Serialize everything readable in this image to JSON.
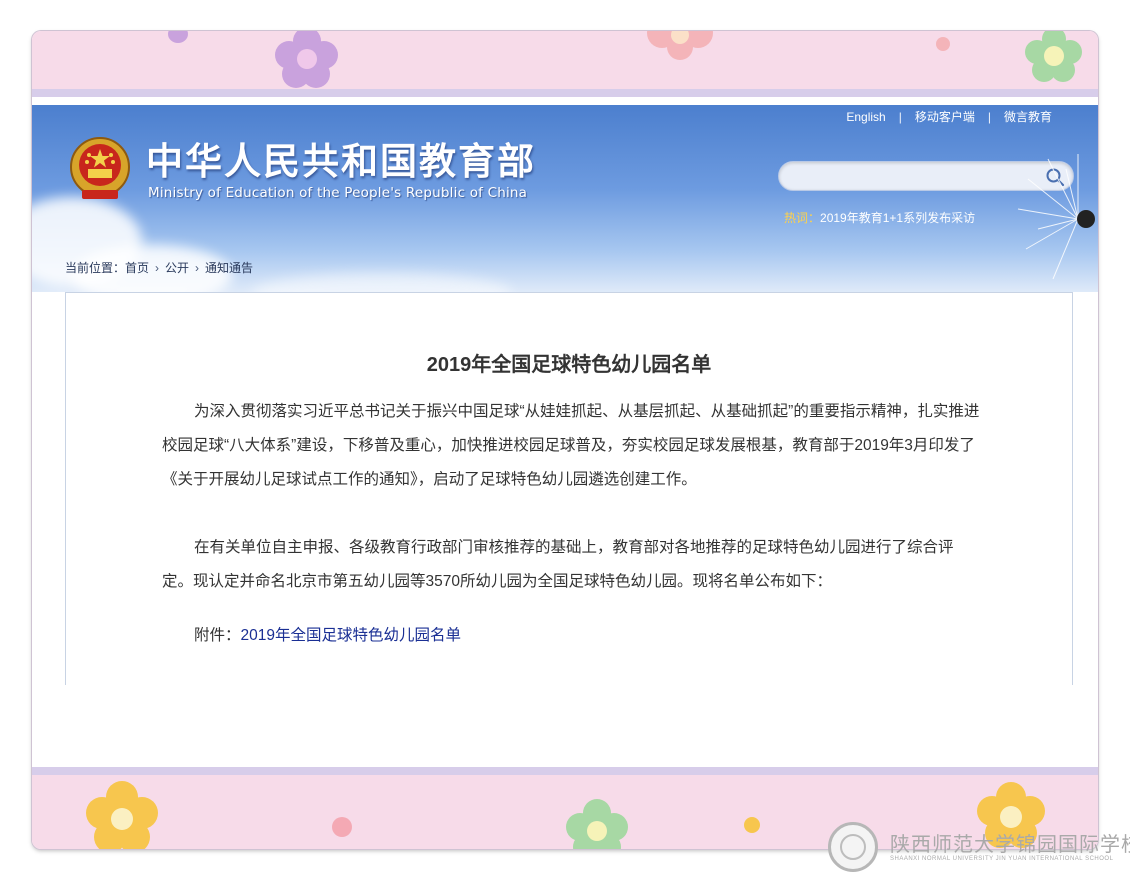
{
  "header": {
    "title_cn": "中华人民共和国教育部",
    "title_en": "Ministry of Education of the People's Republic of China",
    "links": [
      "English",
      "移动客户端",
      "微言教育"
    ],
    "link_separator": "|",
    "search": {
      "placeholder": "",
      "icon": "search-icon"
    },
    "hot": {
      "label": "热词：",
      "text": "2019年教育1+1系列发布采访"
    }
  },
  "breadcrumb": {
    "prefix": "当前位置：",
    "items": [
      "首页",
      "公开",
      "通知通告"
    ]
  },
  "article": {
    "title": "2019年全国足球特色幼儿园名单",
    "paragraphs": [
      "为深入贯彻落实习近平总书记关于振兴中国足球“从娃娃抓起、从基层抓起、从基础抓起”的重要指示精神，扎实推进校园足球“八大体系”建设，下移普及重心，加快推进校园足球普及，夯实校园足球发展根基，教育部于2019年3月印发了《关于开展幼儿足球试点工作的通知》，启动了足球特色幼儿园遴选创建工作。",
      "在有关单位自主申报、各级教育行政部门审核推荐的基础上，教育部对各地推荐的足球特色幼儿园进行了综合评定。现认定并命名北京市第五幼儿园等3570所幼儿园为全国足球特色幼儿园。现将名单公布如下："
    ],
    "attachment_label": "附件：",
    "attachment_link": "2019年全国足球特色幼儿园名单"
  },
  "watermark": {
    "name_cn": "陕西师范大学锦园国际学校",
    "name_en": "SHAANXI NORMAL UNIVERSITY JIN YUAN INTERNATIONAL SCHOOL"
  },
  "colors": {
    "banner_top": "#4c7fce",
    "frame_pink": "#f7dbe9",
    "stripe_lavender": "#d7cdea",
    "link_blue": "#1a2f94",
    "hot_label": "#ffd24a"
  }
}
